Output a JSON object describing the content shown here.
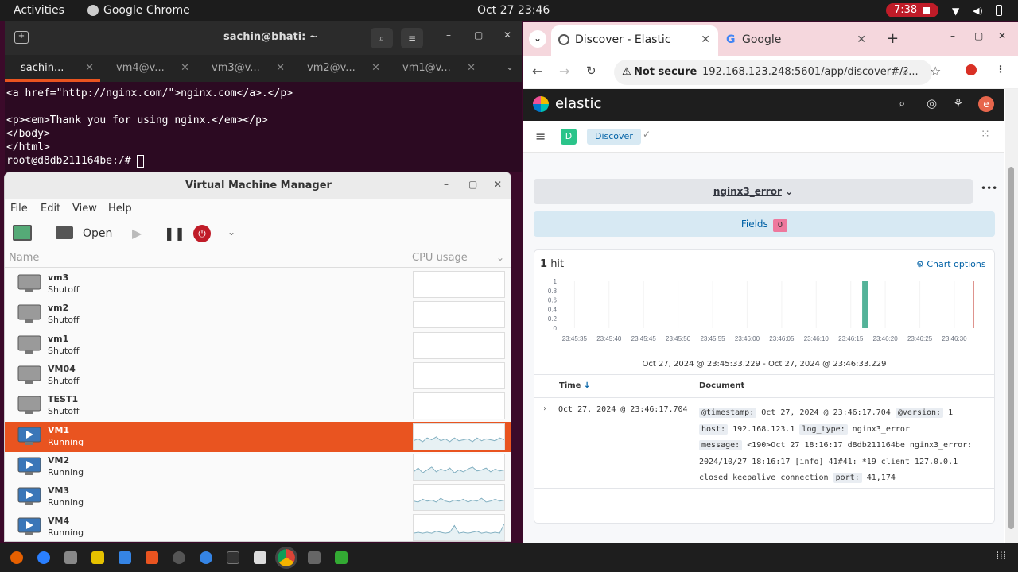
{
  "topbar": {
    "activities": "Activities",
    "app": "Google Chrome",
    "clock": "Oct 27  23:46",
    "rec_time": "7:38"
  },
  "terminal": {
    "title": "sachin@bhati: ~",
    "tabs": [
      "sachin...",
      "vm4@v...",
      "vm3@v...",
      "vm2@v...",
      "vm1@v..."
    ],
    "lines": [
      "<a href=\"http://nginx.com/\">nginx.com</a>.</p>",
      "",
      "<p><em>Thank you for using nginx.</em></p>",
      "</body>",
      "</html>",
      "root@d8db211164be:/# "
    ]
  },
  "vmm": {
    "title": "Virtual Machine Manager",
    "menu": {
      "file": "File",
      "edit": "Edit",
      "view": "View",
      "help": "Help"
    },
    "toolbar": {
      "open": "Open"
    },
    "columns": {
      "name": "Name",
      "cpu": "CPU usage"
    },
    "vms": [
      {
        "name": "vm3",
        "status": "Shutoff"
      },
      {
        "name": "vm2",
        "status": "Shutoff"
      },
      {
        "name": "vm1",
        "status": "Shutoff"
      },
      {
        "name": "VM04",
        "status": "Shutoff"
      },
      {
        "name": "TEST1",
        "status": "Shutoff"
      },
      {
        "name": "VM1",
        "status": "Running"
      },
      {
        "name": "VM2",
        "status": "Running"
      },
      {
        "name": "VM3",
        "status": "Running"
      },
      {
        "name": "VM4",
        "status": "Running"
      }
    ]
  },
  "chrome": {
    "tab1": "Discover - Elastic",
    "tab2": "Google",
    "not_secure": "Not secure",
    "url": "192.168.123.248:5601/app/discover#/?...",
    "avatar": "e"
  },
  "elastic": {
    "brand": "elastic",
    "space": "D",
    "nav_item": "Discover",
    "index_pattern": "nginx3_error",
    "fields_label": "Fields",
    "fields_count": "0",
    "hits_count": "1",
    "hits_label": "hit",
    "chart_options": "Chart options",
    "time_range": "Oct 27, 2024 @ 23:45:33.229 - Oct 27, 2024 @ 23:46:33.229",
    "col_time": "Time",
    "col_document": "Document",
    "row": {
      "time": "Oct 27, 2024 @ 23:46:17.704",
      "k_timestamp": "@timestamp:",
      "v_timestamp": "Oct 27, 2024 @ 23:46:17.704",
      "k_version": "@version:",
      "v_version": "1",
      "k_host": "host:",
      "v_host": "192.168.123.1",
      "k_logtype": "log_type:",
      "v_logtype": "nginx3_error",
      "k_message": "message:",
      "v_message1": "<190>Oct 27 18:16:17 d8db211164be nginx3_error:",
      "v_message2": "2024/10/27 18:16:17 [info] 41#41: *19 client 127.0.0.1",
      "v_message3": "closed keepalive connection",
      "k_port": "port:",
      "v_port": "41,174"
    }
  },
  "chart_data": {
    "type": "bar",
    "title": "",
    "x": [
      "23:45:35",
      "23:45:40",
      "23:45:45",
      "23:45:50",
      "23:45:55",
      "23:46:00",
      "23:46:05",
      "23:46:10",
      "23:46:15",
      "23:46:20",
      "23:46:25",
      "23:46:30"
    ],
    "yticks": [
      "0",
      "0.2",
      "0.4",
      "0.6",
      "0.8",
      "1"
    ],
    "ylim": [
      0,
      1
    ],
    "bars": [
      {
        "time": "23:46:17",
        "value": 1
      }
    ],
    "series_color": "#54b399"
  }
}
